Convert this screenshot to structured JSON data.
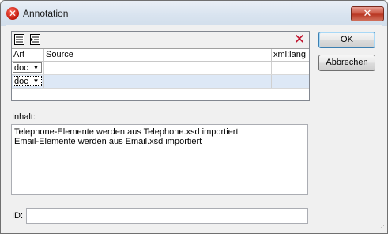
{
  "window": {
    "title": "Annotation",
    "close_glyph": "✕",
    "app_icon_glyph": "✕"
  },
  "grid": {
    "toolbar": {
      "append_icon": "append-row-icon",
      "insert_icon": "insert-row-icon",
      "delete_glyph": "✕"
    },
    "columns": [
      "Art",
      "Source",
      "xml:lang"
    ],
    "rows": [
      {
        "art": "doc",
        "source": "",
        "lang": ""
      },
      {
        "art": "doc",
        "source": "",
        "lang": ""
      }
    ],
    "combo_arrow": "▼"
  },
  "buttons": {
    "ok": "OK",
    "cancel": "Abbrechen"
  },
  "content": {
    "label": "Inhalt:",
    "lines": [
      "Telephone-Elemente werden aus Telephone.xsd importiert",
      "Email-Elemente werden aus Email.xsd importiert"
    ]
  },
  "id": {
    "label": "ID:",
    "value": ""
  }
}
